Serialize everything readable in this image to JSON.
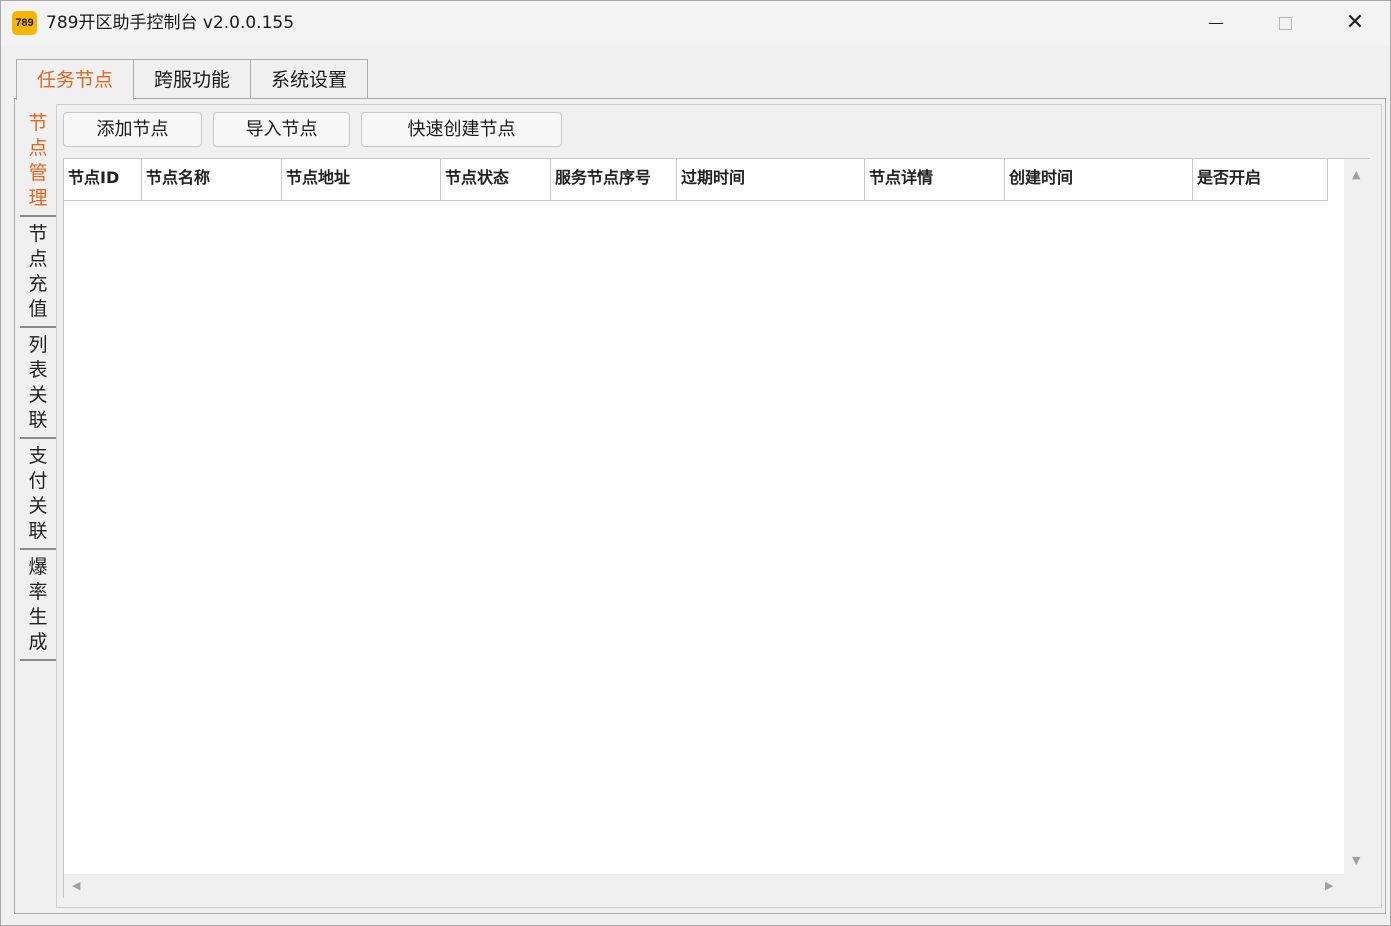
{
  "window": {
    "icon_text": "789",
    "title": "789开区助手控制台 v2.0.0.155"
  },
  "main_tabs": [
    {
      "label": "任务节点",
      "active": true
    },
    {
      "label": "跨服功能",
      "active": false
    },
    {
      "label": "系统设置",
      "active": false
    }
  ],
  "side_tabs": [
    {
      "label": "节点管理",
      "active": true
    },
    {
      "label": "节点充值",
      "active": false
    },
    {
      "label": "列表关联",
      "active": false
    },
    {
      "label": "支付关联",
      "active": false
    },
    {
      "label": "爆率生成",
      "active": false
    }
  ],
  "toolbar": {
    "add_label": "添加节点",
    "import_label": "导入节点",
    "quick_label": "快速创建节点"
  },
  "table": {
    "columns": [
      "节点ID",
      "节点名称",
      "节点地址",
      "节点状态",
      "服务节点序号",
      "过期时间",
      "节点详情",
      "创建时间",
      "是否开启"
    ],
    "rows": []
  },
  "colors": {
    "accent": "#e8651c",
    "icon_bg": "#f7b500"
  }
}
